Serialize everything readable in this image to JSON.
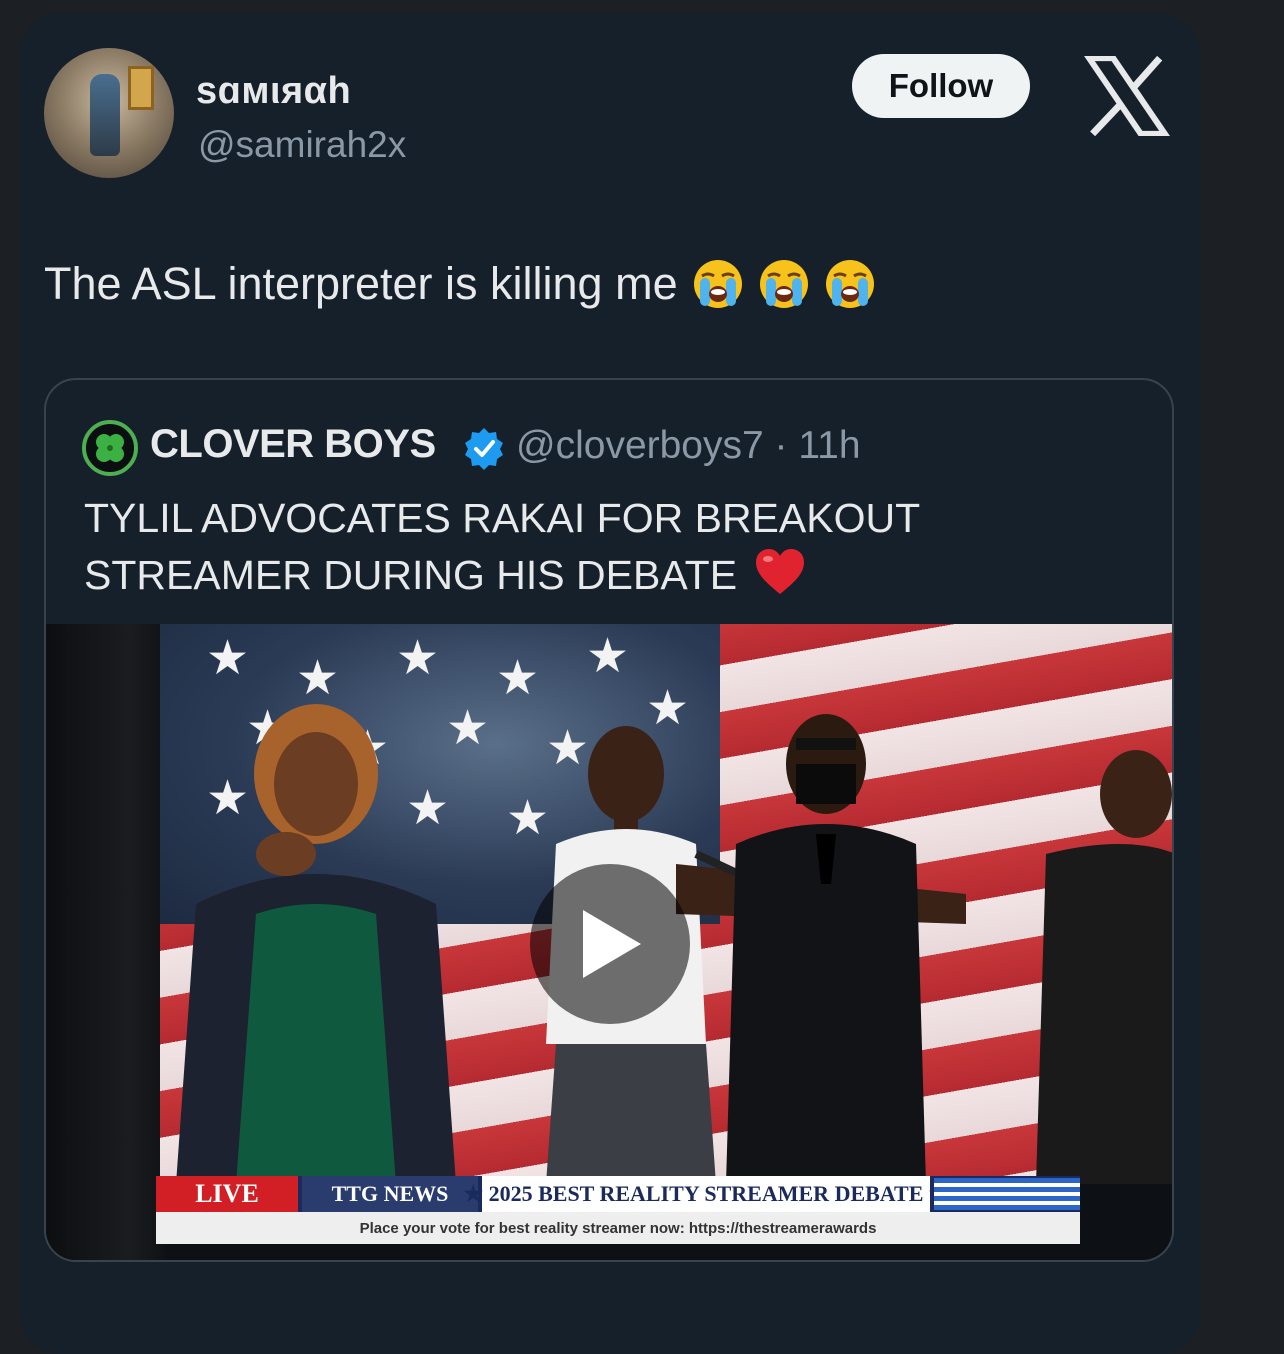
{
  "post": {
    "display_name": "sɑмιяαh",
    "handle": "@samirah2x",
    "follow_label": "Follow",
    "text": "The ASL interpreter is killing me",
    "emojis": [
      "loudly-crying-face",
      "loudly-crying-face",
      "loudly-crying-face"
    ],
    "platform_icon": "x-logo-icon"
  },
  "quoted_post": {
    "display_name": "CLOVER BOYS",
    "verified": true,
    "handle": "@cloverboys7",
    "separator": "·",
    "time": "11h",
    "text": "TYLIL ADVOCATES RAKAI FOR BREAKOUT STREAMER DURING HIS DEBATE",
    "emoji": "red-heart",
    "avatar_icon": "four-leaf-clover-icon",
    "media": {
      "type": "video",
      "play_icon": "play-icon",
      "ticker": {
        "live": "LIVE",
        "network": "TTG NEWS",
        "headline": "★   2025 BEST REALITY STREAMER DEBATE   ★",
        "crawl": "Place your vote for best reality streamer now: https://thestreamerawards"
      }
    }
  },
  "colors": {
    "background": "#15202b",
    "text": "#e7e9ea",
    "secondary_text": "#8b98a5",
    "verified_blue": "#1d9bf0",
    "follow_bg": "#eff3f4"
  }
}
